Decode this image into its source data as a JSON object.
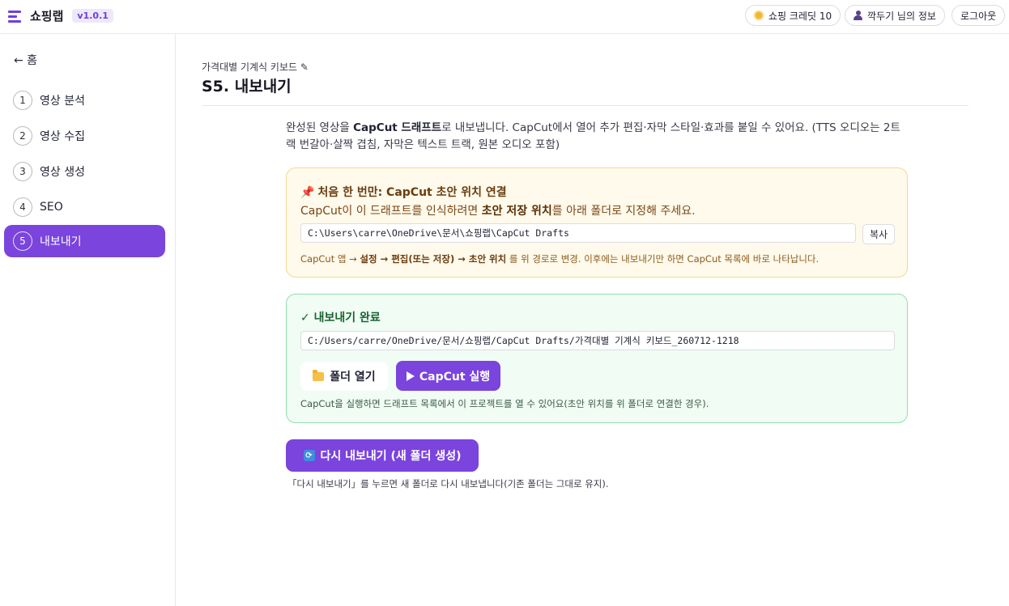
{
  "app": {
    "name": "쇼핑랩",
    "version": "v1.0.1"
  },
  "header": {
    "credits": "쇼핑 크레딧 10",
    "user_info": "깍두기 님의 정보",
    "logout": "로그아웃"
  },
  "sidebar": {
    "back": "← 홈",
    "items": [
      {
        "num": "1",
        "label": "영상 분석"
      },
      {
        "num": "2",
        "label": "영상 수집"
      },
      {
        "num": "3",
        "label": "영상 생성"
      },
      {
        "num": "4",
        "label": "SEO"
      },
      {
        "num": "5",
        "label": "내보내기",
        "active": true
      }
    ]
  },
  "page": {
    "breadcrumb": "가격대별 기계식 키보드 ✎",
    "title": "S5. 내보내기",
    "desc_pre": "완성된 영상을 ",
    "desc_bold": "CapCut 드래프트",
    "desc_post": "로 내보냅니다. CapCut에서 열어 추가 편집·자막 스타일·효과를 붙일 수 있어요. (TTS 오디오는 2트랙 번갈아·살짝 겹침, 자막은 텍스트 트랙, 원본 오디오 포함)"
  },
  "setup_card": {
    "pin_icon": "📌",
    "title": "처음 한 번만: CapCut 초안 위치 연결",
    "text_pre": "CapCut이 이 드래프트를 인식하려면 ",
    "text_bold": "초안 저장 위치",
    "text_post": "를 아래 폴더로 지정해 주세요.",
    "path": "C:\\Users\\carre\\OneDrive\\문서\\쇼핑랩\\CapCut Drafts",
    "copy_label": "복사",
    "note_pre": "CapCut 앱 → ",
    "note_b1": "설정",
    "note_arrow1": " → ",
    "note_b2": "편집(또는 저장)",
    "note_arrow2": " → ",
    "note_b3": "초안 위치",
    "note_post": " 를 위 경로로 변경. 이후에는 내보내기만 하면 CapCut 목록에 바로 나타납니다."
  },
  "done_card": {
    "title": "✓ 내보내기 완료",
    "path": "C:/Users/carre/OneDrive/문서/쇼핑랩/CapCut Drafts/가격대별 기계식 키보드_260712-1218",
    "open_folder": "폴더 열기",
    "run_capcut": "CapCut 실행",
    "note": "CapCut을 실행하면 드래프트 목록에서 이 프로젝트를 열 수 있어요(초안 위치를 위 폴더로 연결한 경우)."
  },
  "reexport": {
    "button": "다시 내보내기 (새 폴더 생성)",
    "note": "「다시 내보내기」를 누르면 새 폴더로 다시 내보냅니다(기존 폴더는 그대로 유지)."
  },
  "colors": {
    "accent": "#7a44dd",
    "warn_bg": "#fffaeb",
    "ok_bg": "#f0fcf4"
  },
  "icons": [
    "menu-logo-icon",
    "coin-icon",
    "user-icon",
    "pin-icon",
    "folder-icon",
    "play-icon",
    "refresh-icon"
  ]
}
